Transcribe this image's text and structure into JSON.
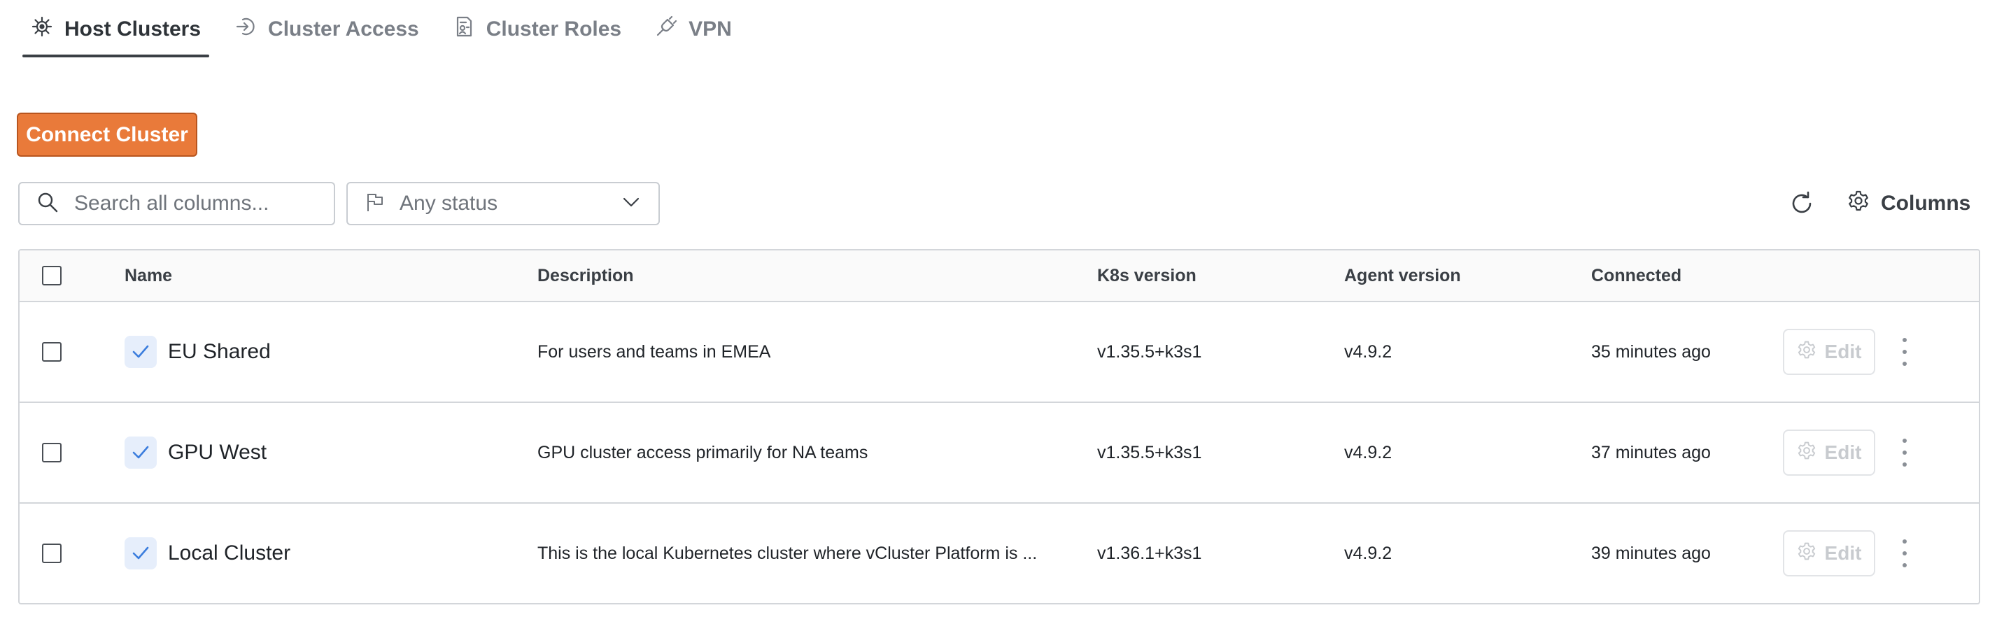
{
  "tabs": [
    {
      "label": "Host Clusters",
      "icon": "helm-icon",
      "active": true
    },
    {
      "label": "Cluster Access",
      "icon": "sign-in-icon",
      "active": false
    },
    {
      "label": "Cluster Roles",
      "icon": "role-document-icon",
      "active": false
    },
    {
      "label": "VPN",
      "icon": "plug-icon",
      "active": false
    }
  ],
  "toolbar": {
    "connect_label": "Connect Cluster",
    "search_placeholder": "Search all columns...",
    "status_filter": "Any status",
    "columns_label": "Columns",
    "accent_color": "#e97a3a"
  },
  "table": {
    "headers": {
      "name": "Name",
      "description": "Description",
      "k8s": "K8s version",
      "agent": "Agent version",
      "connected": "Connected"
    },
    "edit_label": "Edit",
    "rows": [
      {
        "name": "EU Shared",
        "description": "For users and teams in EMEA",
        "k8s": "v1.35.5+k3s1",
        "agent": "v4.9.2",
        "connected": "35 minutes ago"
      },
      {
        "name": "GPU West",
        "description": "GPU cluster access primarily for NA teams",
        "k8s": "v1.35.5+k3s1",
        "agent": "v4.9.2",
        "connected": "37 minutes ago"
      },
      {
        "name": "Local Cluster",
        "description": "This is the local Kubernetes cluster where vCluster Platform is ...",
        "k8s": "v1.36.1+k3s1",
        "agent": "v4.9.2",
        "connected": "39 minutes ago"
      }
    ]
  }
}
